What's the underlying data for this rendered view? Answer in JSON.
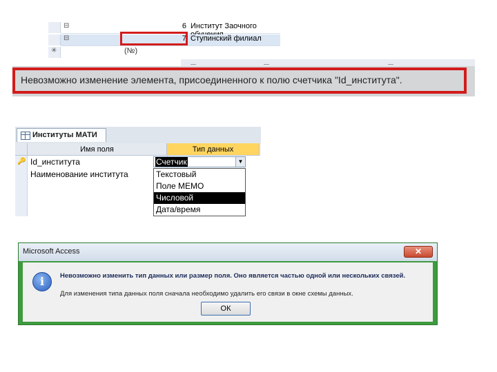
{
  "records_view": {
    "rows": [
      {
        "expander": "⊟",
        "number": "6",
        "name": "Институт Заочного обучения"
      },
      {
        "expander": "⊟",
        "number": "7",
        "name": "Ступинский филиал"
      }
    ],
    "new_row": {
      "marker": "✳",
      "label": "(№)"
    }
  },
  "status_bar": {
    "message": "Невозможно изменение элемента, присоединенного к полю счетчика \"Id_института\"."
  },
  "table_design": {
    "tab_label": "Институты МАТИ",
    "columns": {
      "field_name": "Имя поля",
      "data_type": "Тип данных"
    },
    "fields": [
      {
        "name": "Id_института"
      },
      {
        "name": "Наименование института"
      }
    ],
    "combo_value": "Счетчик",
    "dropdown_options": [
      "Текстовый",
      "Поле MEMO",
      "Числовой",
      "Дата/время"
    ],
    "highlighted_option": "Числовой"
  },
  "dialog": {
    "title": "Microsoft Access",
    "close_glyph": "✕",
    "message_main": "Невозможно изменить тип данных или размер поля. Оно является частью одной или нескольких связей.",
    "message_hint": "Для изменения типа данных поля сначала необходимо удалить его связи в окне схемы данных.",
    "ok_label": "ОК"
  },
  "colors": {
    "highlight_red": "#d21c1c",
    "header_orange": "#ffd560",
    "dialog_green": "#3e9a3e"
  }
}
